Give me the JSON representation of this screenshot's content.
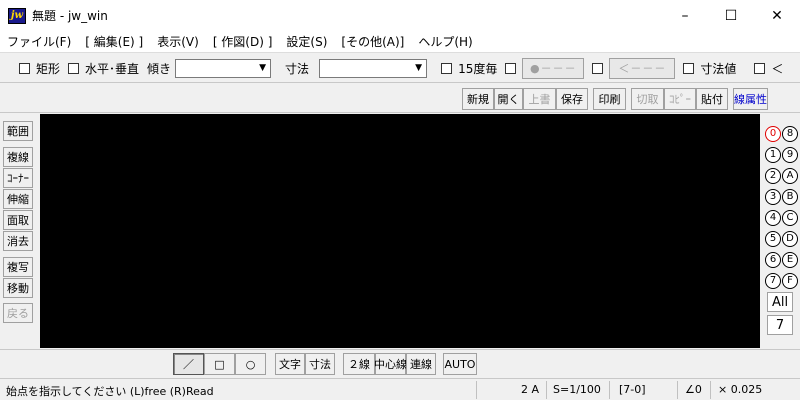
{
  "window": {
    "title": "無題 - jw_win",
    "icon_label": "jw",
    "minimize": "–",
    "maximize": "☐",
    "close": "✕"
  },
  "menu": [
    "ファイル(F)",
    "[ 編集(E) ]",
    "表示(V)",
    "[ 作図(D) ]",
    "設定(S)",
    "[その他(A)]",
    "ヘルプ(H)"
  ],
  "toolbar1": {
    "rect_label": "矩形",
    "hv_label": "水平･垂直",
    "tilt_label": "傾き",
    "tilt_value": "",
    "dim_label": "寸法",
    "dim_value": "",
    "deg15_label": "15度毎",
    "pt_button": "●－－－",
    "back_button": "＜－－－",
    "dimval_label": "寸法値",
    "lt_label": "＜"
  },
  "toolbar2": [
    "新規",
    "開く",
    "上書",
    "保存",
    "印刷",
    "切取",
    "ｺﾋﾟｰ",
    "貼付",
    "線属性"
  ],
  "left_tools": [
    "範囲",
    "複線",
    "ｺｰﾅｰ",
    "伸縮",
    "面取",
    "消去",
    "複写",
    "移動",
    "戻る"
  ],
  "layers": {
    "left": [
      "0",
      "1",
      "2",
      "3",
      "4",
      "5",
      "6",
      "7"
    ],
    "right": [
      "8",
      "9",
      "A",
      "B",
      "C",
      "D",
      "E",
      "F"
    ],
    "all_button": "All",
    "group_button": "7"
  },
  "bottom_tools": {
    "line": "／",
    "rect": "□",
    "circle": "○",
    "text": "文字",
    "dim": "寸法",
    "double": "２線",
    "center": "中心線",
    "continuous": "連線",
    "auto": "AUTO"
  },
  "status": {
    "message": "始点を指示してください (L)free (R)Read",
    "paper": "2 A",
    "scale": "S=1/100",
    "layer": "[7-0]",
    "angle": "∠0",
    "factor": "× 0.025"
  }
}
